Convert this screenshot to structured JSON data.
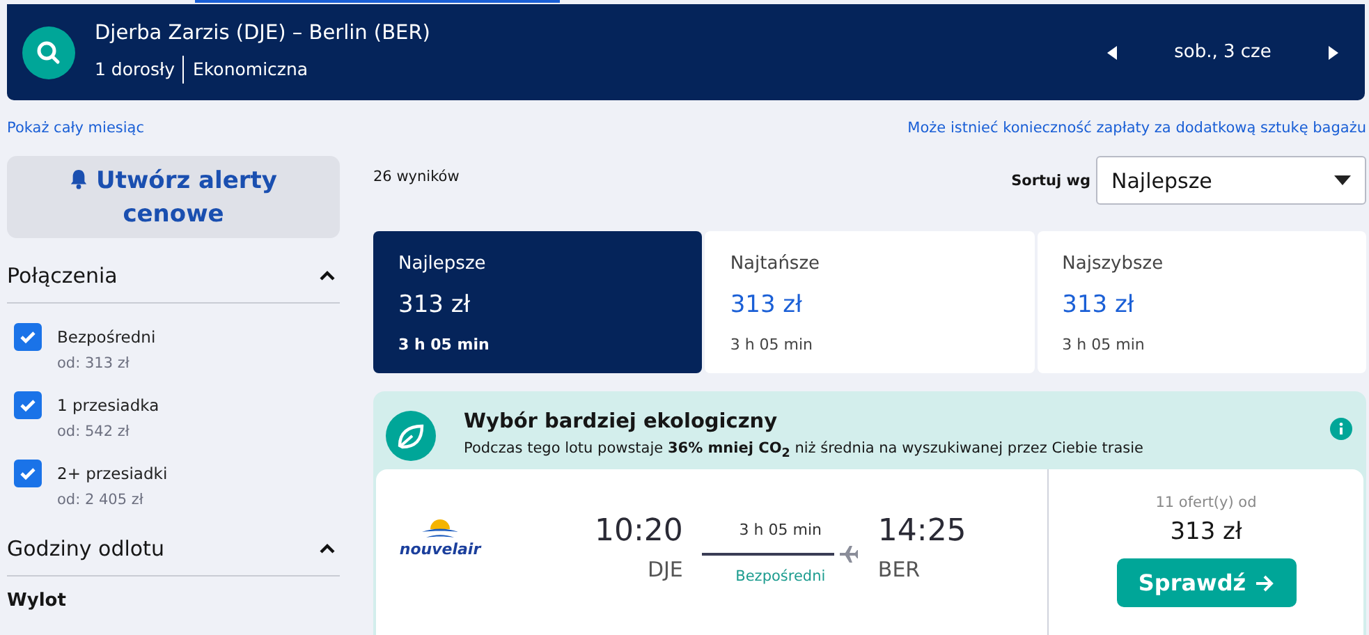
{
  "header": {
    "route": "Djerba Zarzis (DJE) – Berlin (BER)",
    "passengers": "1 dorosły",
    "cabin_class": "Ekonomiczna",
    "date": "sob., 3 cze"
  },
  "links": {
    "month": "Pokaż cały miesiąc",
    "baggage": "Może istnieć konieczność zapłaty za dodatkową sztukę bagażu"
  },
  "alert_button": "Utwórz alerty cenowe",
  "filters": [
    {
      "title": "Połączenia",
      "expanded": true,
      "options": [
        {
          "label": "Bezpośredni",
          "price": "od: 313 zł",
          "checked": true
        },
        {
          "label": "1 przesiadka",
          "price": "od: 542 zł",
          "checked": true
        },
        {
          "label": "2+ przesiadki",
          "price": "od: 2 405 zł",
          "checked": true
        }
      ]
    },
    {
      "title": "Godziny odlotu",
      "expanded": true,
      "subtitle": "Wylot"
    }
  ],
  "results_count": "26 wyników",
  "sort": {
    "label": "Sortuj wg",
    "value": "Najlepsze"
  },
  "sort_tabs": [
    {
      "label": "Najlepsze",
      "price": "313 zł",
      "duration": "3 h 05 min",
      "selected": true
    },
    {
      "label": "Najtańsze",
      "price": "313 zł",
      "duration": "3 h 05 min",
      "selected": false
    },
    {
      "label": "Najszybsze",
      "price": "313 zł",
      "duration": "3 h 05 min",
      "selected": false
    }
  ],
  "eco_banner": {
    "title": "Wybór bardziej ekologiczny",
    "text": "Podczas tego lotu powstaje **36% mniej CO$_{2}$** niż średnia na wyszukiwanej przez Ciebie trasie"
  },
  "flight": {
    "airline": "nouvelair",
    "depart_time": "10:20",
    "depart_airport": "DJE",
    "duration": "3 h 05 min",
    "stops": "Bezpośredni",
    "arrive_time": "14:25",
    "arrive_airport": "BER",
    "offers": "11 ofert(y) od",
    "price": "313 zł",
    "button": "Sprawdź"
  }
}
